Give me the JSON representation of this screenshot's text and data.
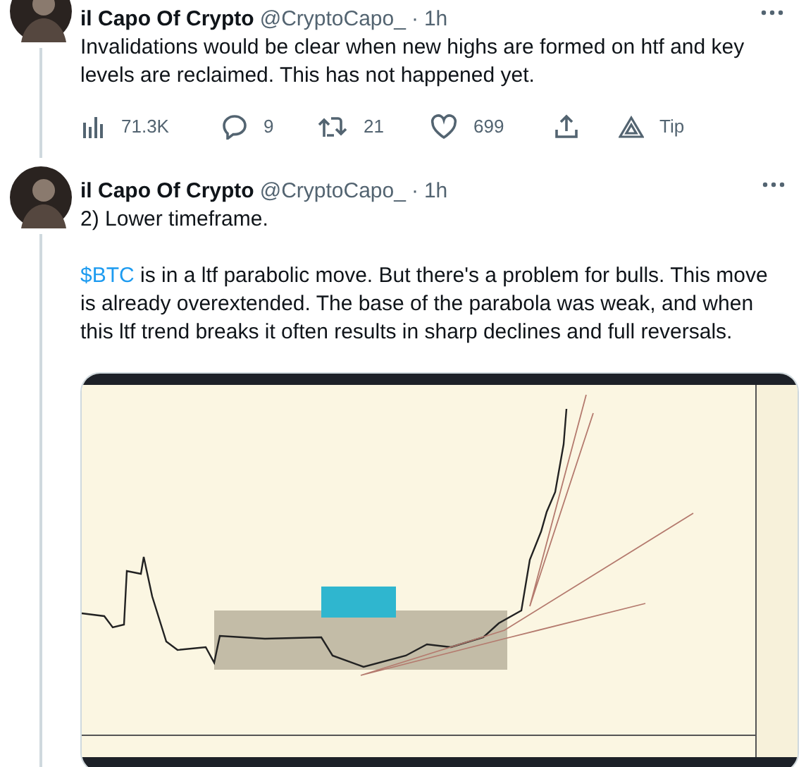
{
  "tweets": [
    {
      "author": "il Capo Of Crypto",
      "handle": "@CryptoCapo_",
      "separator": "·",
      "time": "1h",
      "paragraphs": [
        [
          {
            "kind": "text",
            "text": "Invalidations would be clear when new highs are formed on htf and key levels are reclaimed. This has not happened yet."
          }
        ]
      ],
      "actions": [
        {
          "kind": "views",
          "count": "71.3K"
        },
        {
          "kind": "reply",
          "count": "9"
        },
        {
          "kind": "retweet",
          "count": "21"
        },
        {
          "kind": "like",
          "count": "699"
        },
        {
          "kind": "share"
        },
        {
          "kind": "tip",
          "count": "Tip"
        }
      ]
    },
    {
      "author": "il Capo Of Crypto",
      "handle": "@CryptoCapo_",
      "separator": "·",
      "time": "1h",
      "paragraphs": [
        [
          {
            "kind": "text",
            "text": "2) Lower timeframe."
          }
        ],
        [
          {
            "kind": "cashtag",
            "text": "$BTC"
          },
          {
            "kind": "text",
            "text": " is in a ltf parabolic move. But there's a problem for bulls. This move is already overextended. The base of the parabola was weak, and when this ltf trend breaks it often results in sharp declines and full reversals."
          }
        ]
      ],
      "media": {
        "kind": "picture"
      }
    }
  ]
}
